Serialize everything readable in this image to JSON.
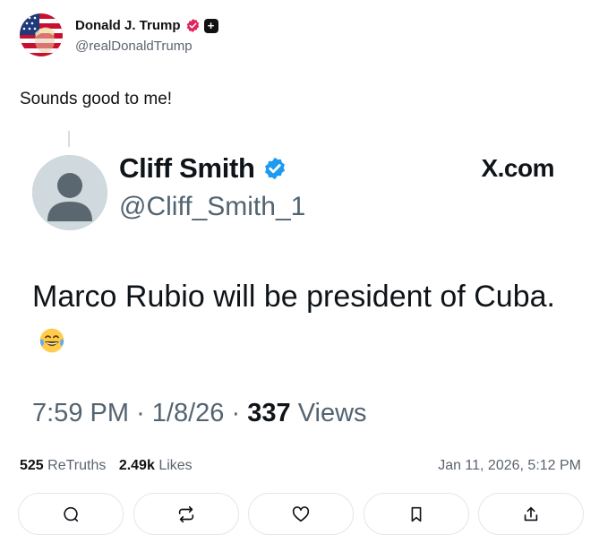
{
  "author": {
    "display_name": "Donald J. Trump",
    "handle": "@realDonaldTrump"
  },
  "post": {
    "text": "Sounds good to me!"
  },
  "quoted": {
    "display_name": "Cliff Smith",
    "handle": "@Cliff_Smith_1",
    "source": "X.com",
    "text": "Marco Rubio will be president of Cuba.",
    "emoji": "face-with-tears-of-joy",
    "time": "7:59 PM",
    "date": "1/8/26",
    "views_count": "337",
    "views_label": "Views",
    "sep": "·"
  },
  "stats": {
    "retruths_count": "525",
    "retruths_label": "ReTruths",
    "likes_count": "2.49k",
    "likes_label": "Likes",
    "timestamp": "Jan 11, 2026, 5:12 PM"
  },
  "actions": [
    "reply-icon",
    "retruth-icon",
    "like-icon",
    "bookmark-icon",
    "share-icon"
  ],
  "colors": {
    "verified_pink": "#e0245e",
    "verified_blue": "#1d9bf0",
    "text_dark": "#0f1419",
    "text_muted": "#536471"
  }
}
